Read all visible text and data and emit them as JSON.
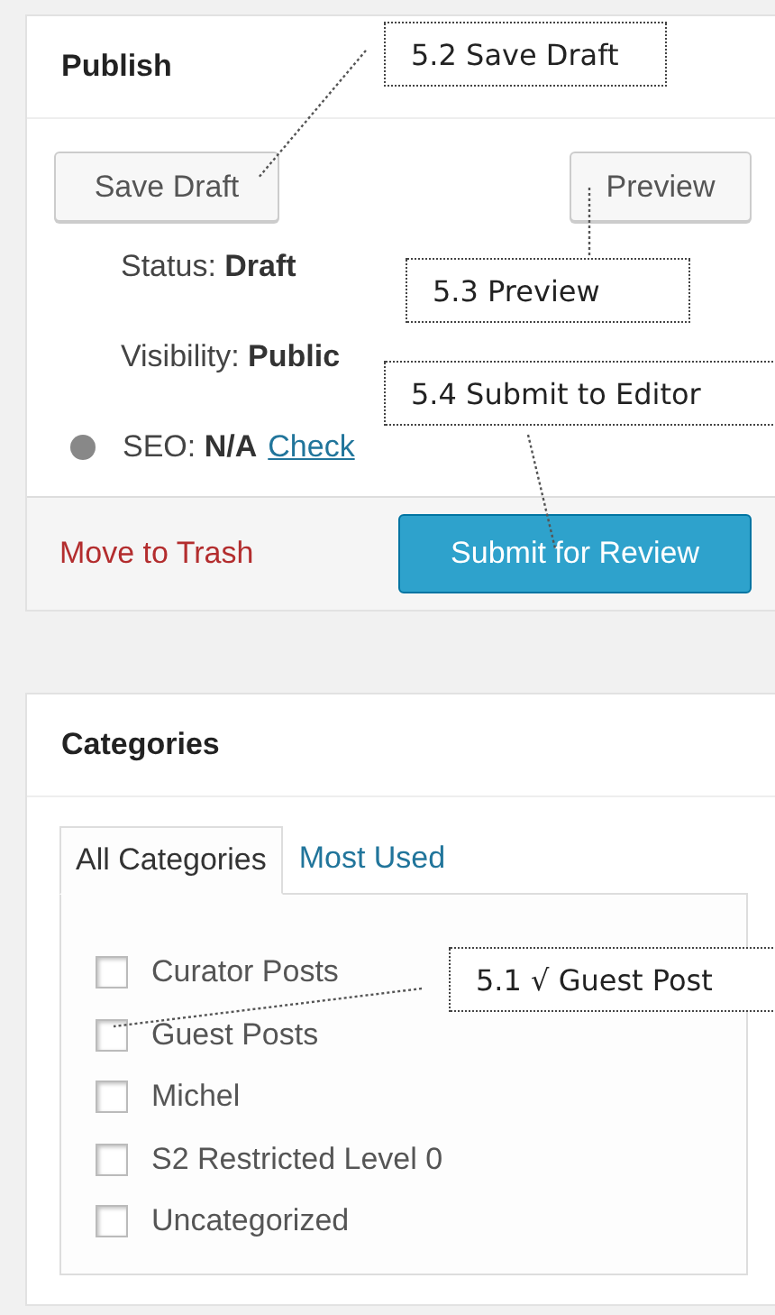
{
  "publish": {
    "title": "Publish",
    "save_draft": "Save Draft",
    "preview": "Preview",
    "status": {
      "label": "Status:",
      "value": "Draft"
    },
    "visibility": {
      "label": "Visibility:",
      "value": "Public"
    },
    "seo": {
      "label": "SEO:",
      "value": "N/A",
      "link": "Check"
    },
    "move_to_trash": "Move to Trash",
    "submit": "Submit for Review"
  },
  "categories": {
    "title": "Categories",
    "tabs": [
      {
        "label": "All Categories",
        "selected": true
      },
      {
        "label": "Most Used",
        "selected": false
      }
    ],
    "items": [
      {
        "label": "Curator Posts",
        "checked": false
      },
      {
        "label": "Guest Posts",
        "checked": false
      },
      {
        "label": "Michel",
        "checked": false
      },
      {
        "label": "S2 Restricted Level 0",
        "checked": false
      },
      {
        "label": "Uncategorized",
        "checked": false
      }
    ]
  },
  "annotations": [
    {
      "text": "5.2 Save Draft"
    },
    {
      "text": "5.3 Preview"
    },
    {
      "text": "5.4 Submit to Editor"
    },
    {
      "text": "5.1 √ Guest Post"
    }
  ]
}
